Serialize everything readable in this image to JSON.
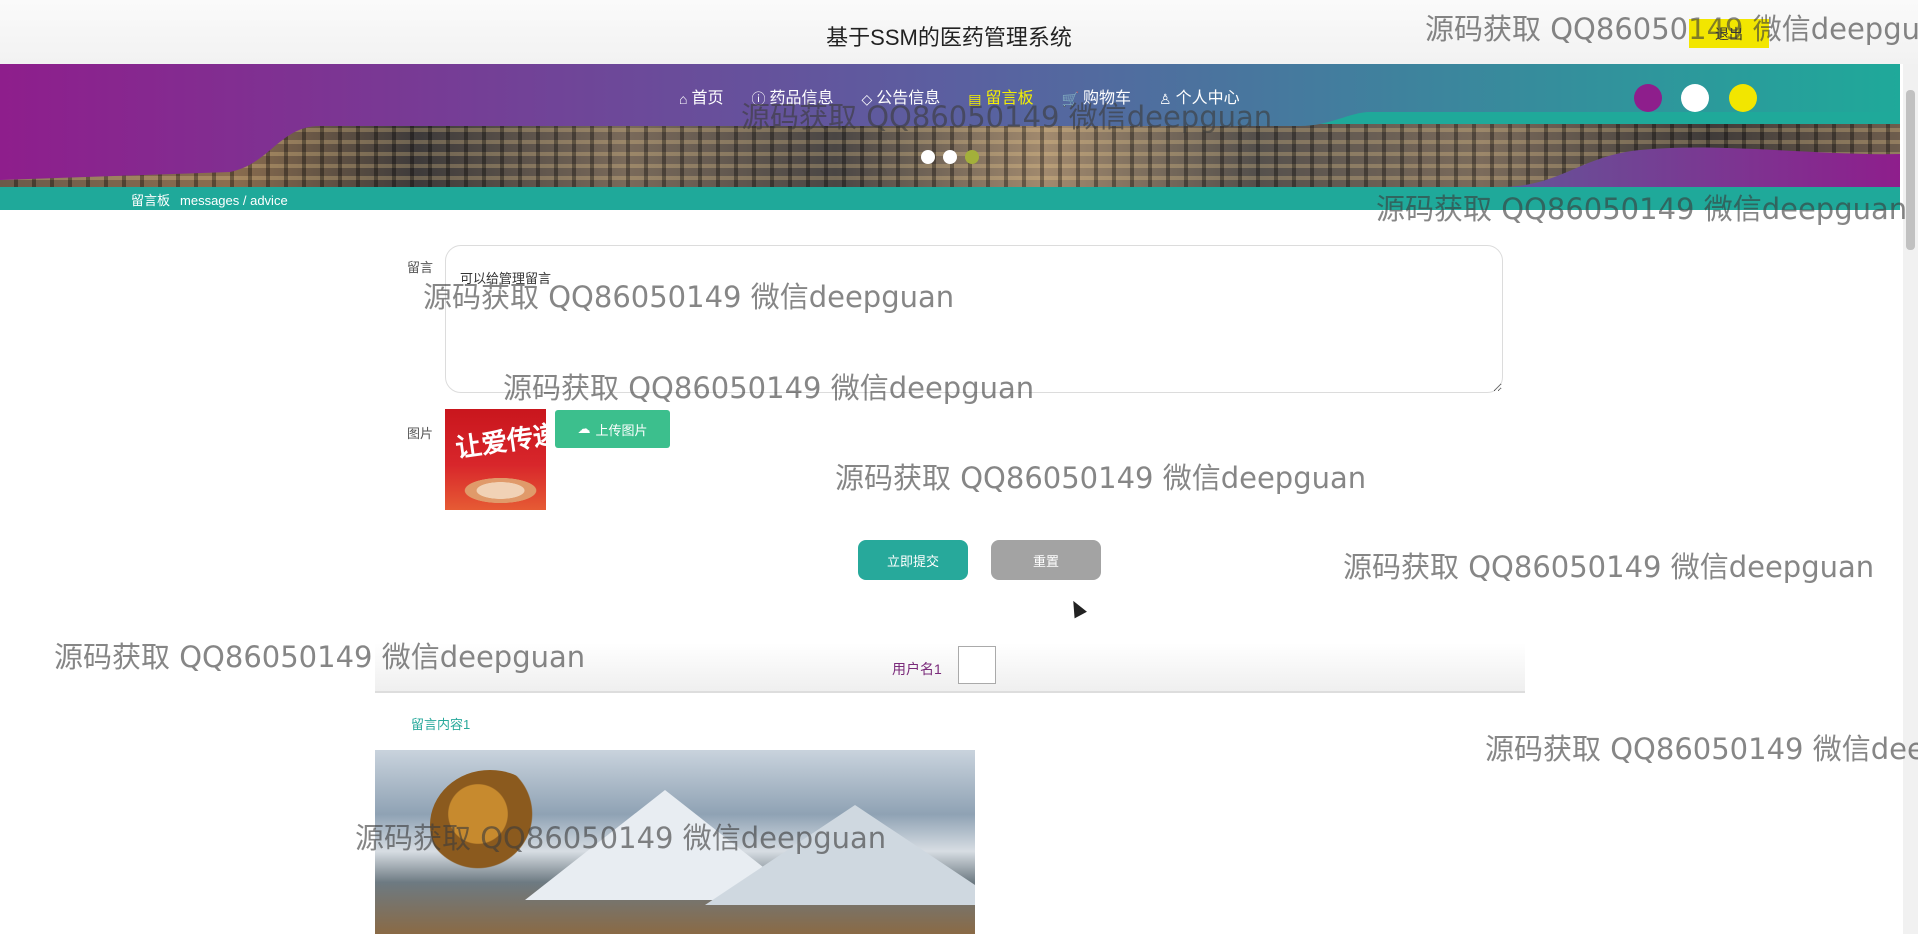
{
  "header": {
    "title": "基于SSM的医药管理系统",
    "logout_label": "退出"
  },
  "nav": {
    "items": [
      {
        "label": "首页",
        "icon": "home-icon",
        "glyph": "⌂"
      },
      {
        "label": "药品信息",
        "icon": "info-icon",
        "glyph": "ⓘ"
      },
      {
        "label": "公告信息",
        "icon": "tag-icon",
        "glyph": "◇"
      },
      {
        "label": "留言板",
        "icon": "message-icon",
        "glyph": "▤"
      },
      {
        "label": "购物车",
        "icon": "cart-icon",
        "glyph": "🛒"
      },
      {
        "label": "个人中心",
        "icon": "user-icon",
        "glyph": "♙"
      }
    ],
    "active_index": 3,
    "active_color": "#f6f000"
  },
  "theme": {
    "dots": [
      "#8e1e8c",
      "#ffffff",
      "#f2e600"
    ]
  },
  "slider": {
    "dot_count": 3,
    "active_index": 2,
    "active_color": "#a3b03a"
  },
  "breadcrumb": {
    "title": "留言板",
    "sub": "messages / advice"
  },
  "form": {
    "message_label": "留言",
    "message_placeholder": "可以给管理留言",
    "image_label": "图片",
    "preview_text": "让爱传递",
    "upload_label": "上传图片",
    "submit_label": "立即提交",
    "reset_label": "重置"
  },
  "messages": [
    {
      "username": "用户名1",
      "content": "留言内容1"
    }
  ],
  "watermark": "源码获取 QQ86050149 微信deepguan",
  "colors": {
    "teal": "#1fa99a",
    "purple": "#8e1e8c",
    "yellow": "#f2e600",
    "green": "#3cbf8d"
  }
}
